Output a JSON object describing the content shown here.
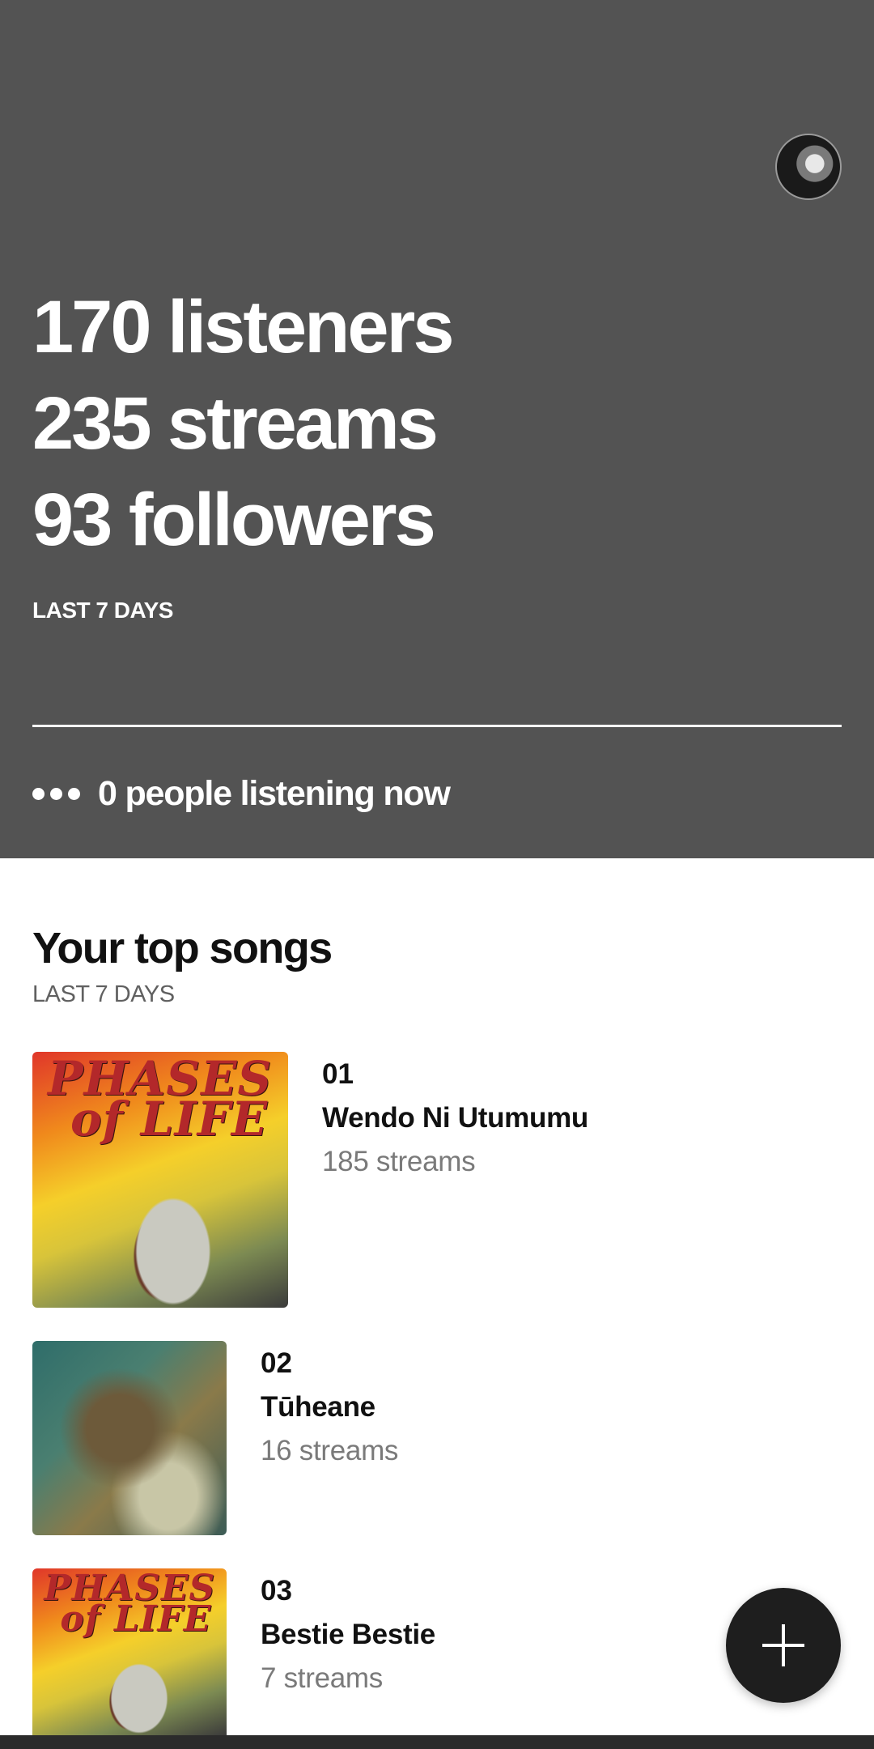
{
  "stats": {
    "listeners": "170 listeners",
    "streams": "235 streams",
    "followers": "93 followers",
    "period": "LAST 7 DAYS"
  },
  "live": {
    "text": "0 people listening now"
  },
  "top_songs": {
    "title": "Your top songs",
    "period": "LAST 7 DAYS",
    "items": [
      {
        "rank": "01",
        "title": "Wendo Ni Utumumu",
        "streams": "185 streams",
        "art_text_1": "PHASES",
        "art_text_2": "of LIFE"
      },
      {
        "rank": "02",
        "title": "Tūheane",
        "streams": "16 streams"
      },
      {
        "rank": "03",
        "title": "Bestie Bestie",
        "streams": "7 streams",
        "art_text_1": "PHASES",
        "art_text_2": "of LIFE"
      }
    ]
  },
  "icons": {
    "avatar": "profile-avatar",
    "live": "dots-icon",
    "fab": "plus-icon"
  },
  "colors": {
    "header_bg": "#535353",
    "fab_bg": "#1e1e1e",
    "muted_text": "#7a7a7a"
  }
}
